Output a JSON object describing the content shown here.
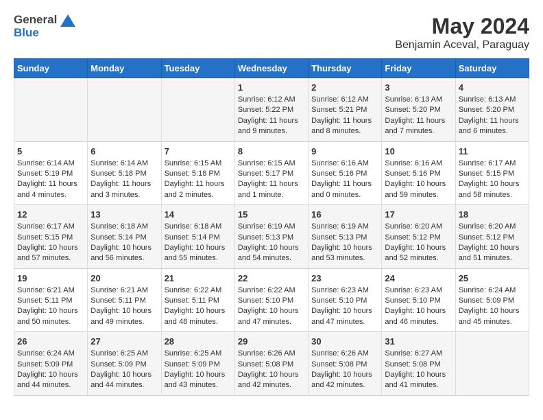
{
  "logo": {
    "general": "General",
    "blue": "Blue"
  },
  "title": {
    "month_year": "May 2024",
    "location": "Benjamin Aceval, Paraguay"
  },
  "headers": [
    "Sunday",
    "Monday",
    "Tuesday",
    "Wednesday",
    "Thursday",
    "Friday",
    "Saturday"
  ],
  "weeks": [
    [
      {
        "day": "",
        "info": ""
      },
      {
        "day": "",
        "info": ""
      },
      {
        "day": "",
        "info": ""
      },
      {
        "day": "1",
        "info": "Sunrise: 6:12 AM\nSunset: 5:22 PM\nDaylight: 11 hours and 9 minutes."
      },
      {
        "day": "2",
        "info": "Sunrise: 6:12 AM\nSunset: 5:21 PM\nDaylight: 11 hours and 8 minutes."
      },
      {
        "day": "3",
        "info": "Sunrise: 6:13 AM\nSunset: 5:20 PM\nDaylight: 11 hours and 7 minutes."
      },
      {
        "day": "4",
        "info": "Sunrise: 6:13 AM\nSunset: 5:20 PM\nDaylight: 11 hours and 6 minutes."
      }
    ],
    [
      {
        "day": "5",
        "info": "Sunrise: 6:14 AM\nSunset: 5:19 PM\nDaylight: 11 hours and 4 minutes."
      },
      {
        "day": "6",
        "info": "Sunrise: 6:14 AM\nSunset: 5:18 PM\nDaylight: 11 hours and 3 minutes."
      },
      {
        "day": "7",
        "info": "Sunrise: 6:15 AM\nSunset: 5:18 PM\nDaylight: 11 hours and 2 minutes."
      },
      {
        "day": "8",
        "info": "Sunrise: 6:15 AM\nSunset: 5:17 PM\nDaylight: 11 hours and 1 minute."
      },
      {
        "day": "9",
        "info": "Sunrise: 6:16 AM\nSunset: 5:16 PM\nDaylight: 11 hours and 0 minutes."
      },
      {
        "day": "10",
        "info": "Sunrise: 6:16 AM\nSunset: 5:16 PM\nDaylight: 10 hours and 59 minutes."
      },
      {
        "day": "11",
        "info": "Sunrise: 6:17 AM\nSunset: 5:15 PM\nDaylight: 10 hours and 58 minutes."
      }
    ],
    [
      {
        "day": "12",
        "info": "Sunrise: 6:17 AM\nSunset: 5:15 PM\nDaylight: 10 hours and 57 minutes."
      },
      {
        "day": "13",
        "info": "Sunrise: 6:18 AM\nSunset: 5:14 PM\nDaylight: 10 hours and 56 minutes."
      },
      {
        "day": "14",
        "info": "Sunrise: 6:18 AM\nSunset: 5:14 PM\nDaylight: 10 hours and 55 minutes."
      },
      {
        "day": "15",
        "info": "Sunrise: 6:19 AM\nSunset: 5:13 PM\nDaylight: 10 hours and 54 minutes."
      },
      {
        "day": "16",
        "info": "Sunrise: 6:19 AM\nSunset: 5:13 PM\nDaylight: 10 hours and 53 minutes."
      },
      {
        "day": "17",
        "info": "Sunrise: 6:20 AM\nSunset: 5:12 PM\nDaylight: 10 hours and 52 minutes."
      },
      {
        "day": "18",
        "info": "Sunrise: 6:20 AM\nSunset: 5:12 PM\nDaylight: 10 hours and 51 minutes."
      }
    ],
    [
      {
        "day": "19",
        "info": "Sunrise: 6:21 AM\nSunset: 5:11 PM\nDaylight: 10 hours and 50 minutes."
      },
      {
        "day": "20",
        "info": "Sunrise: 6:21 AM\nSunset: 5:11 PM\nDaylight: 10 hours and 49 minutes."
      },
      {
        "day": "21",
        "info": "Sunrise: 6:22 AM\nSunset: 5:11 PM\nDaylight: 10 hours and 48 minutes."
      },
      {
        "day": "22",
        "info": "Sunrise: 6:22 AM\nSunset: 5:10 PM\nDaylight: 10 hours and 47 minutes."
      },
      {
        "day": "23",
        "info": "Sunrise: 6:23 AM\nSunset: 5:10 PM\nDaylight: 10 hours and 47 minutes."
      },
      {
        "day": "24",
        "info": "Sunrise: 6:23 AM\nSunset: 5:10 PM\nDaylight: 10 hours and 46 minutes."
      },
      {
        "day": "25",
        "info": "Sunrise: 6:24 AM\nSunset: 5:09 PM\nDaylight: 10 hours and 45 minutes."
      }
    ],
    [
      {
        "day": "26",
        "info": "Sunrise: 6:24 AM\nSunset: 5:09 PM\nDaylight: 10 hours and 44 minutes."
      },
      {
        "day": "27",
        "info": "Sunrise: 6:25 AM\nSunset: 5:09 PM\nDaylight: 10 hours and 44 minutes."
      },
      {
        "day": "28",
        "info": "Sunrise: 6:25 AM\nSunset: 5:09 PM\nDaylight: 10 hours and 43 minutes."
      },
      {
        "day": "29",
        "info": "Sunrise: 6:26 AM\nSunset: 5:08 PM\nDaylight: 10 hours and 42 minutes."
      },
      {
        "day": "30",
        "info": "Sunrise: 6:26 AM\nSunset: 5:08 PM\nDaylight: 10 hours and 42 minutes."
      },
      {
        "day": "31",
        "info": "Sunrise: 6:27 AM\nSunset: 5:08 PM\nDaylight: 10 hours and 41 minutes."
      },
      {
        "day": "",
        "info": ""
      }
    ]
  ]
}
